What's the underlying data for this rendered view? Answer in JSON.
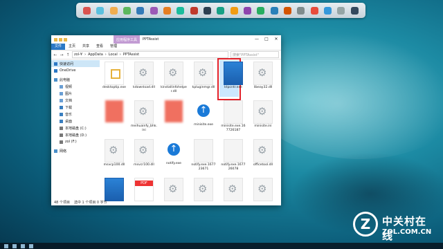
{
  "dock": {
    "icon_colors": [
      "#d9534f",
      "#5bc0de",
      "#f0ad4e",
      "#5cb85c",
      "#337ab7",
      "#9b59b6",
      "#e67e22",
      "#1abc9c",
      "#c0392b",
      "#2c3e50",
      "#16a085",
      "#f39c12",
      "#8e44ad",
      "#27ae60",
      "#2980b9",
      "#d35400",
      "#7f8c8d",
      "#e74c3c",
      "#3498db",
      "#95a5a6",
      "#34495e"
    ]
  },
  "window": {
    "app_tool_tab": "应用程序工具",
    "title": "PPTAssist",
    "buttons": {
      "minimize": "—",
      "maximize": "□",
      "close": "✕"
    },
    "ribbon_tabs": [
      "文件",
      "主页",
      "共享",
      "查看",
      "管理"
    ],
    "address": {
      "path": [
        "zol-¥",
        "AppData",
        "Local",
        "PPTAssist"
      ],
      "search_placeholder": "搜索\"PPTAssist\""
    },
    "nav": {
      "items": [
        {
          "label": "快速访问",
          "icon": "star-icon",
          "color": "#2b78c5"
        },
        {
          "label": "OneDrive",
          "icon": "cloud-icon",
          "color": "#2b78c5"
        },
        {
          "label": "此电脑",
          "icon": "computer-icon",
          "color": "#4a8fc9"
        },
        {
          "label": "视频",
          "icon": "video-icon",
          "color": "#6a9fd4"
        },
        {
          "label": "图片",
          "icon": "picture-icon",
          "color": "#6a9fd4"
        },
        {
          "label": "文档",
          "icon": "document-icon",
          "color": "#6a9fd4"
        },
        {
          "label": "下载",
          "icon": "download-icon",
          "color": "#3a7fc0"
        },
        {
          "label": "音乐",
          "icon": "music-icon",
          "color": "#3a7fc0"
        },
        {
          "label": "桌面",
          "icon": "desktop-icon",
          "color": "#3a7fc0"
        },
        {
          "label": "本地磁盘 (C:)",
          "icon": "drive-icon",
          "color": "#777"
        },
        {
          "label": "本地磁盘 (D:)",
          "icon": "drive-icon",
          "color": "#777"
        },
        {
          "label": "zol (F:)",
          "icon": "drive-icon",
          "color": "#777"
        },
        {
          "label": "网络",
          "icon": "network-icon",
          "color": "#4a8fc9"
        }
      ]
    },
    "files": [
      {
        "name": "desktoptip.exe",
        "icon": "exe-icon"
      },
      {
        "name": "kdownload.dll",
        "icon": "gear-icon"
      },
      {
        "name": "kinstallinfohelper.dll",
        "icon": "gear-icon"
      },
      {
        "name": "kpluginmgr.dll",
        "icon": "gear-icon"
      },
      {
        "name": "ktpcntr.exe",
        "icon": "app-icon",
        "selected": true
      },
      {
        "name": "libeay32.dll",
        "icon": "gear-icon"
      },
      {
        "name": "",
        "icon": "blurred-icon"
      },
      {
        "name": "meihuainfy_bhk.ini",
        "icon": "gear-icon"
      },
      {
        "name": "",
        "icon": "blurred-icon"
      },
      {
        "name": "minisite.exe",
        "icon": "blue-arrow-icon"
      },
      {
        "name": "minisite.exe.167726187",
        "icon": "file-icon"
      },
      {
        "name": "minisite.ini",
        "icon": "gear-icon"
      },
      {
        "name": "msvcp100.dll",
        "icon": "gear-icon"
      },
      {
        "name": "msvcr100.dll",
        "icon": "gear-icon"
      },
      {
        "name": "notify.exe",
        "icon": "blue-arrow-icon"
      },
      {
        "name": "notify.exe.167723671",
        "icon": "file-icon"
      },
      {
        "name": "notify.exe.167726078",
        "icon": "file-icon"
      },
      {
        "name": "officetool.dll",
        "icon": "gear-icon"
      },
      {
        "name": "",
        "icon": "app-icon"
      },
      {
        "name": "",
        "icon": "pdf-icon"
      },
      {
        "name": "",
        "icon": "gear-icon"
      },
      {
        "name": "",
        "icon": "gear-icon"
      },
      {
        "name": "",
        "icon": "gear-icon"
      },
      {
        "name": "",
        "icon": "gear-icon"
      }
    ],
    "status": {
      "count": "48 个项目",
      "selection": "选中 1 个项目 0 字节"
    }
  },
  "logo": {
    "cn": "中关村在线",
    "en": "ZOL.COM.CN",
    "mark": "Z"
  }
}
